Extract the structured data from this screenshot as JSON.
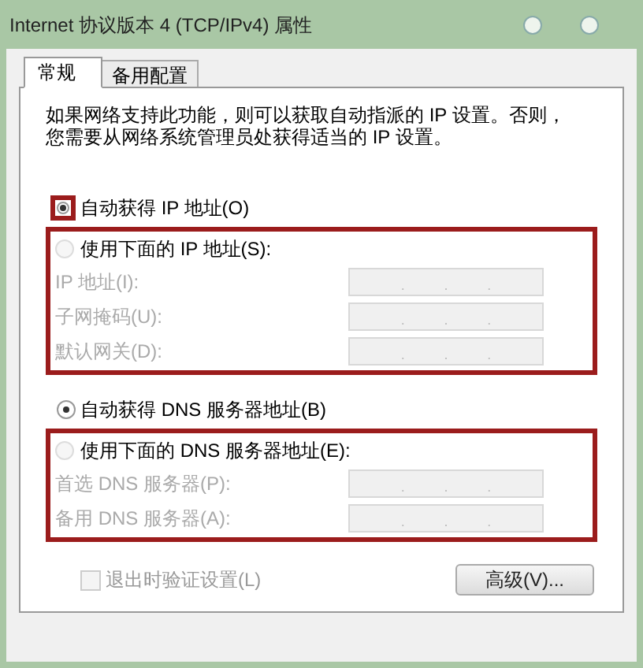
{
  "window": {
    "title": "Internet 协议版本 4 (TCP/IPv4) 属性"
  },
  "tabs": [
    {
      "label": "常规",
      "selected": true
    },
    {
      "label": "备用配置",
      "selected": false
    }
  ],
  "description_lines": [
    "如果网络支持此功能，则可以获取自动指派的 IP 设置。否则，",
    "您需要从网络系统管理员处获得适当的 IP 设置。"
  ],
  "sections": [
    {
      "auto_option": {
        "label": "自动获得 IP 地址(O)",
        "selected": true,
        "highlighted": true
      },
      "manual_option": {
        "label": "使用下面的 IP 地址(S):",
        "selected": false
      },
      "highlighted": true,
      "fields": [
        {
          "label": "IP 地址(I):",
          "separators": [
            ".",
            ".",
            "."
          ],
          "disabled": true
        },
        {
          "label": "子网掩码(U):",
          "separators": [
            ".",
            ".",
            "."
          ],
          "disabled": true
        },
        {
          "label": "默认网关(D):",
          "separators": [
            ".",
            ".",
            "."
          ],
          "disabled": true
        }
      ]
    },
    {
      "auto_option": {
        "label": "自动获得 DNS 服务器地址(B)",
        "selected": true,
        "highlighted": false
      },
      "manual_option": {
        "label": "使用下面的 DNS 服务器地址(E):",
        "selected": false
      },
      "highlighted": true,
      "fields": [
        {
          "label": "首选 DNS 服务器(P):",
          "separators": [
            ".",
            ".",
            "."
          ],
          "disabled": true
        },
        {
          "label": "备用 DNS 服务器(A):",
          "separators": [
            ".",
            ".",
            "."
          ],
          "disabled": true
        }
      ]
    }
  ],
  "validate_checkbox": {
    "label": "退出时验证设置(L)",
    "checked": false,
    "disabled": true
  },
  "advanced_button": {
    "label": "高级(V)..."
  }
}
